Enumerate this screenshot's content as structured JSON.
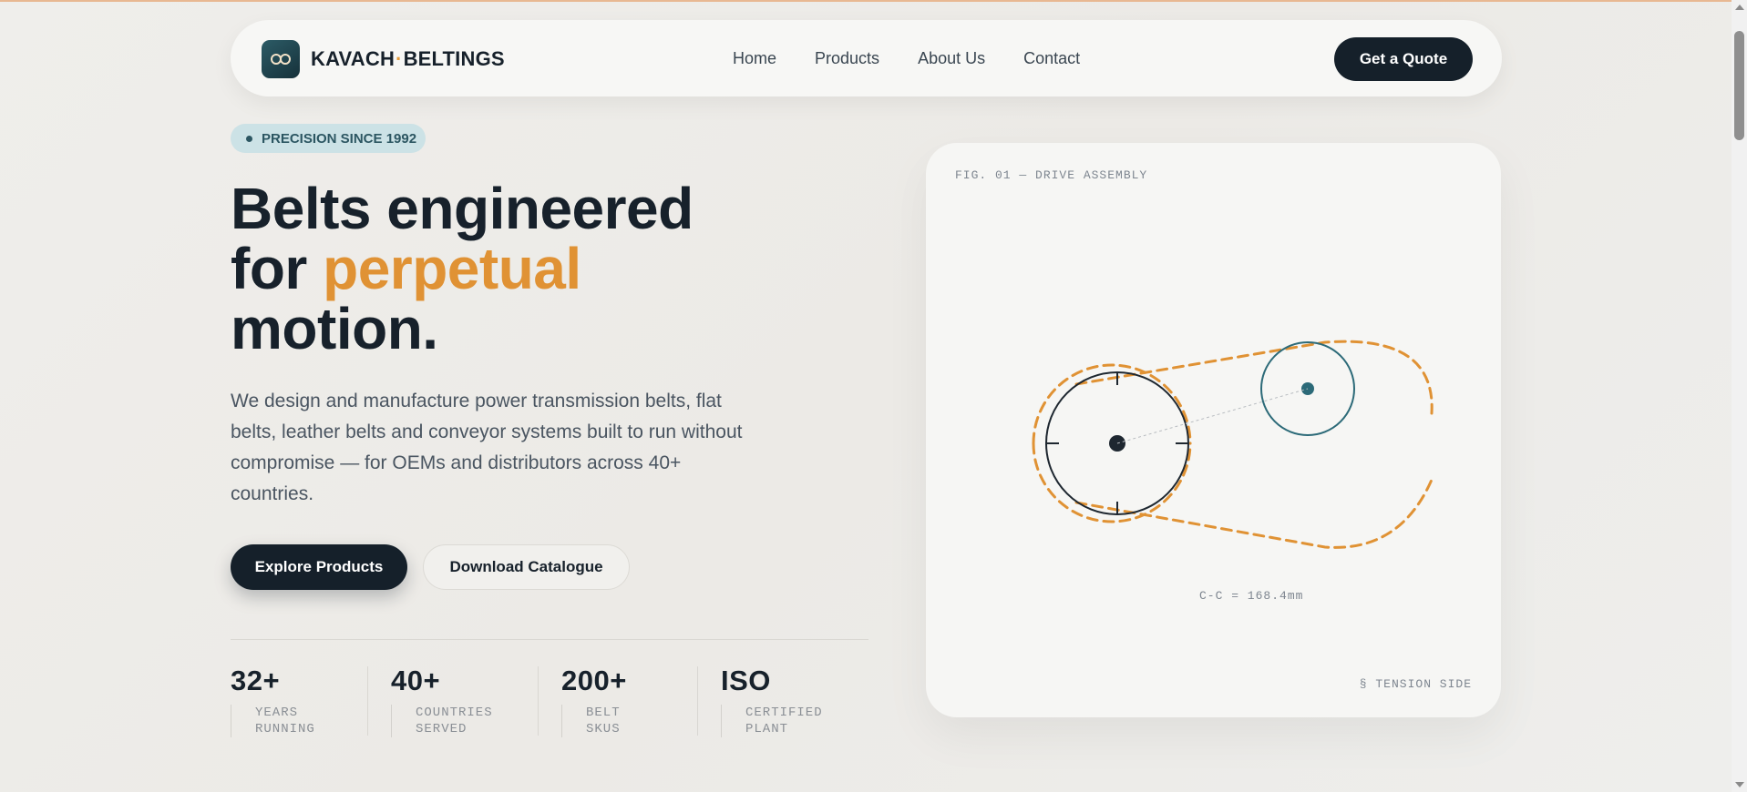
{
  "nav": {
    "brand_left": "KAVACH",
    "brand_sep": "·",
    "brand_right": "BELTINGS",
    "links": [
      "Home",
      "Products",
      "About Us",
      "Contact"
    ],
    "cta": "Get a Quote"
  },
  "hero": {
    "badge": "PRECISION SINCE 1992",
    "headline_line1": "Belts engineered",
    "headline_line2_pre": "for ",
    "headline_accent": "perpetual",
    "headline_line3": "motion.",
    "lead": "We design and manufacture power transmission belts, flat belts, leather belts and conveyor systems built to run without compromise — for OEMs and distributors across 40+ countries.",
    "primary_button": "Explore Products",
    "secondary_button": "Download Catalogue"
  },
  "stats": [
    {
      "value": "32+",
      "label_line1": "YEARS",
      "label_line2": "RUNNING"
    },
    {
      "value": "40+",
      "label_line1": "COUNTRIES",
      "label_line2": "SERVED"
    },
    {
      "value": "200+",
      "label_line1": "BELT",
      "label_line2": "SKUS"
    },
    {
      "value": "ISO",
      "label_line1": "CERTIFIED",
      "label_line2": "PLANT"
    }
  ],
  "figure": {
    "label": "FIG. 01 — DRIVE ASSEMBLY",
    "center_distance": "C-C = 168.4mm",
    "tension_label": "§ TENSION SIDE"
  },
  "colors": {
    "accent": "#e09234",
    "dark": "#15202a",
    "teal": "#2c6a78",
    "badge_bg": "#cce2e6"
  }
}
